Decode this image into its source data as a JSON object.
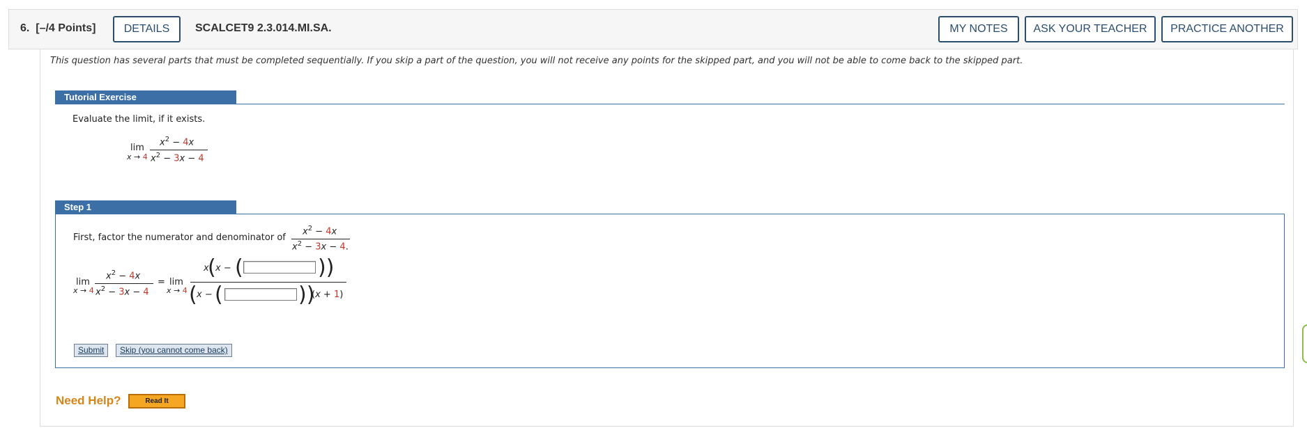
{
  "header": {
    "question_number": "6.",
    "points": "[–/4 Points]",
    "details_label": "DETAILS",
    "question_id": "SCALCET9 2.3.014.MI.SA.",
    "my_notes_label": "MY NOTES",
    "ask_teacher_label": "ASK YOUR TEACHER",
    "practice_another_label": "PRACTICE ANOTHER"
  },
  "notice": "This question has several parts that must be completed sequentially. If you skip a part of the question, you will not receive any points for the skipped part, and you will not be able to come back to the skipped part.",
  "tutorial": {
    "label": "Tutorial Exercise",
    "prompt": "Evaluate the limit, if it exists.",
    "lim": "lim",
    "lim_sub": "x → 4",
    "numerator": "x² − 4x",
    "denominator": "x² − 3x − 4"
  },
  "step1": {
    "label": "Step 1",
    "instruction": "First, factor the numerator and denominator of",
    "frac_numerator": "x² − 4x",
    "frac_denominator": "x² − 3x − 4",
    "eq_lhs_lim": "lim",
    "eq_lhs_sub": "x → 4",
    "eq_rhs_lim": "lim",
    "eq_rhs_sub": "x → 4",
    "equals": "=",
    "rhs_num_prefix": "x",
    "rhs_den_suffix": "(x + 1)",
    "answer_numerator_value": "",
    "answer_denominator_value": "",
    "submit_label": "Submit",
    "skip_label": "Skip (you cannot come back)"
  },
  "help": {
    "need_help": "Need Help?",
    "read_it": "Read It"
  },
  "colors": {
    "accent_blue": "#3c6fa5",
    "button_border": "#2b4e6e",
    "help_orange": "#d4861a",
    "constant_red": "#c0392b"
  }
}
